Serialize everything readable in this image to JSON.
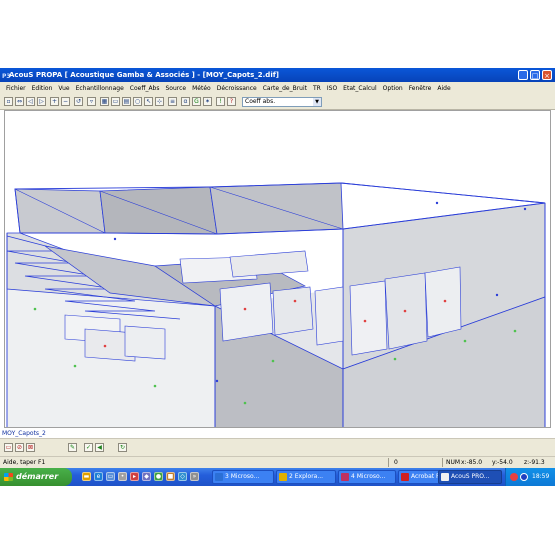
{
  "window": {
    "app_icon": "P3",
    "title": "AcouS PROPA [ Acoustique Gamba & Associés ] - [MOY_Capots_2.dif]",
    "controls": [
      "_",
      "□",
      "×"
    ]
  },
  "menu": {
    "items": [
      "Fichier",
      "Edition",
      "Vue",
      "Echantillonnage",
      "Coeff_Abs",
      "Source",
      "Météo",
      "Décroissance",
      "Carte_de_Bruit",
      "TR",
      "ISO",
      "Etat_Calcul",
      "Option",
      "Fenêtre",
      "Aide"
    ]
  },
  "toolbar": {
    "combo_value": "Coeff abs."
  },
  "canvas": {
    "doc_label": "MOY_Capots_2"
  },
  "statusbar": {
    "help_text": "Aide, taper F1",
    "value": "0",
    "num": "NUM",
    "x": "x:-85.0",
    "y": "y:-54.0",
    "z": "z:-91.3"
  },
  "taskbar": {
    "start_label": "démarrer",
    "tasks": [
      "3 Microso...",
      "2 Explora...",
      "4 Microso...",
      "Acrobat Re...",
      "AcouS PRO..."
    ],
    "clock": "18:59"
  },
  "colors": {
    "wire": "#2b3ed8",
    "title_blue": "#0a57d8",
    "face_gray": "#b8b8c0"
  },
  "icons": {
    "tools": [
      "new-icon",
      "open-icon",
      "save-icon",
      "print-icon",
      "zoom-in-icon",
      "zoom-out-icon",
      "rotate-icon",
      "grid-icon",
      "camera-icon",
      "search-icon",
      "pointer-icon",
      "color-icon",
      "source-icon",
      "calc-icon",
      "help-icon"
    ]
  }
}
